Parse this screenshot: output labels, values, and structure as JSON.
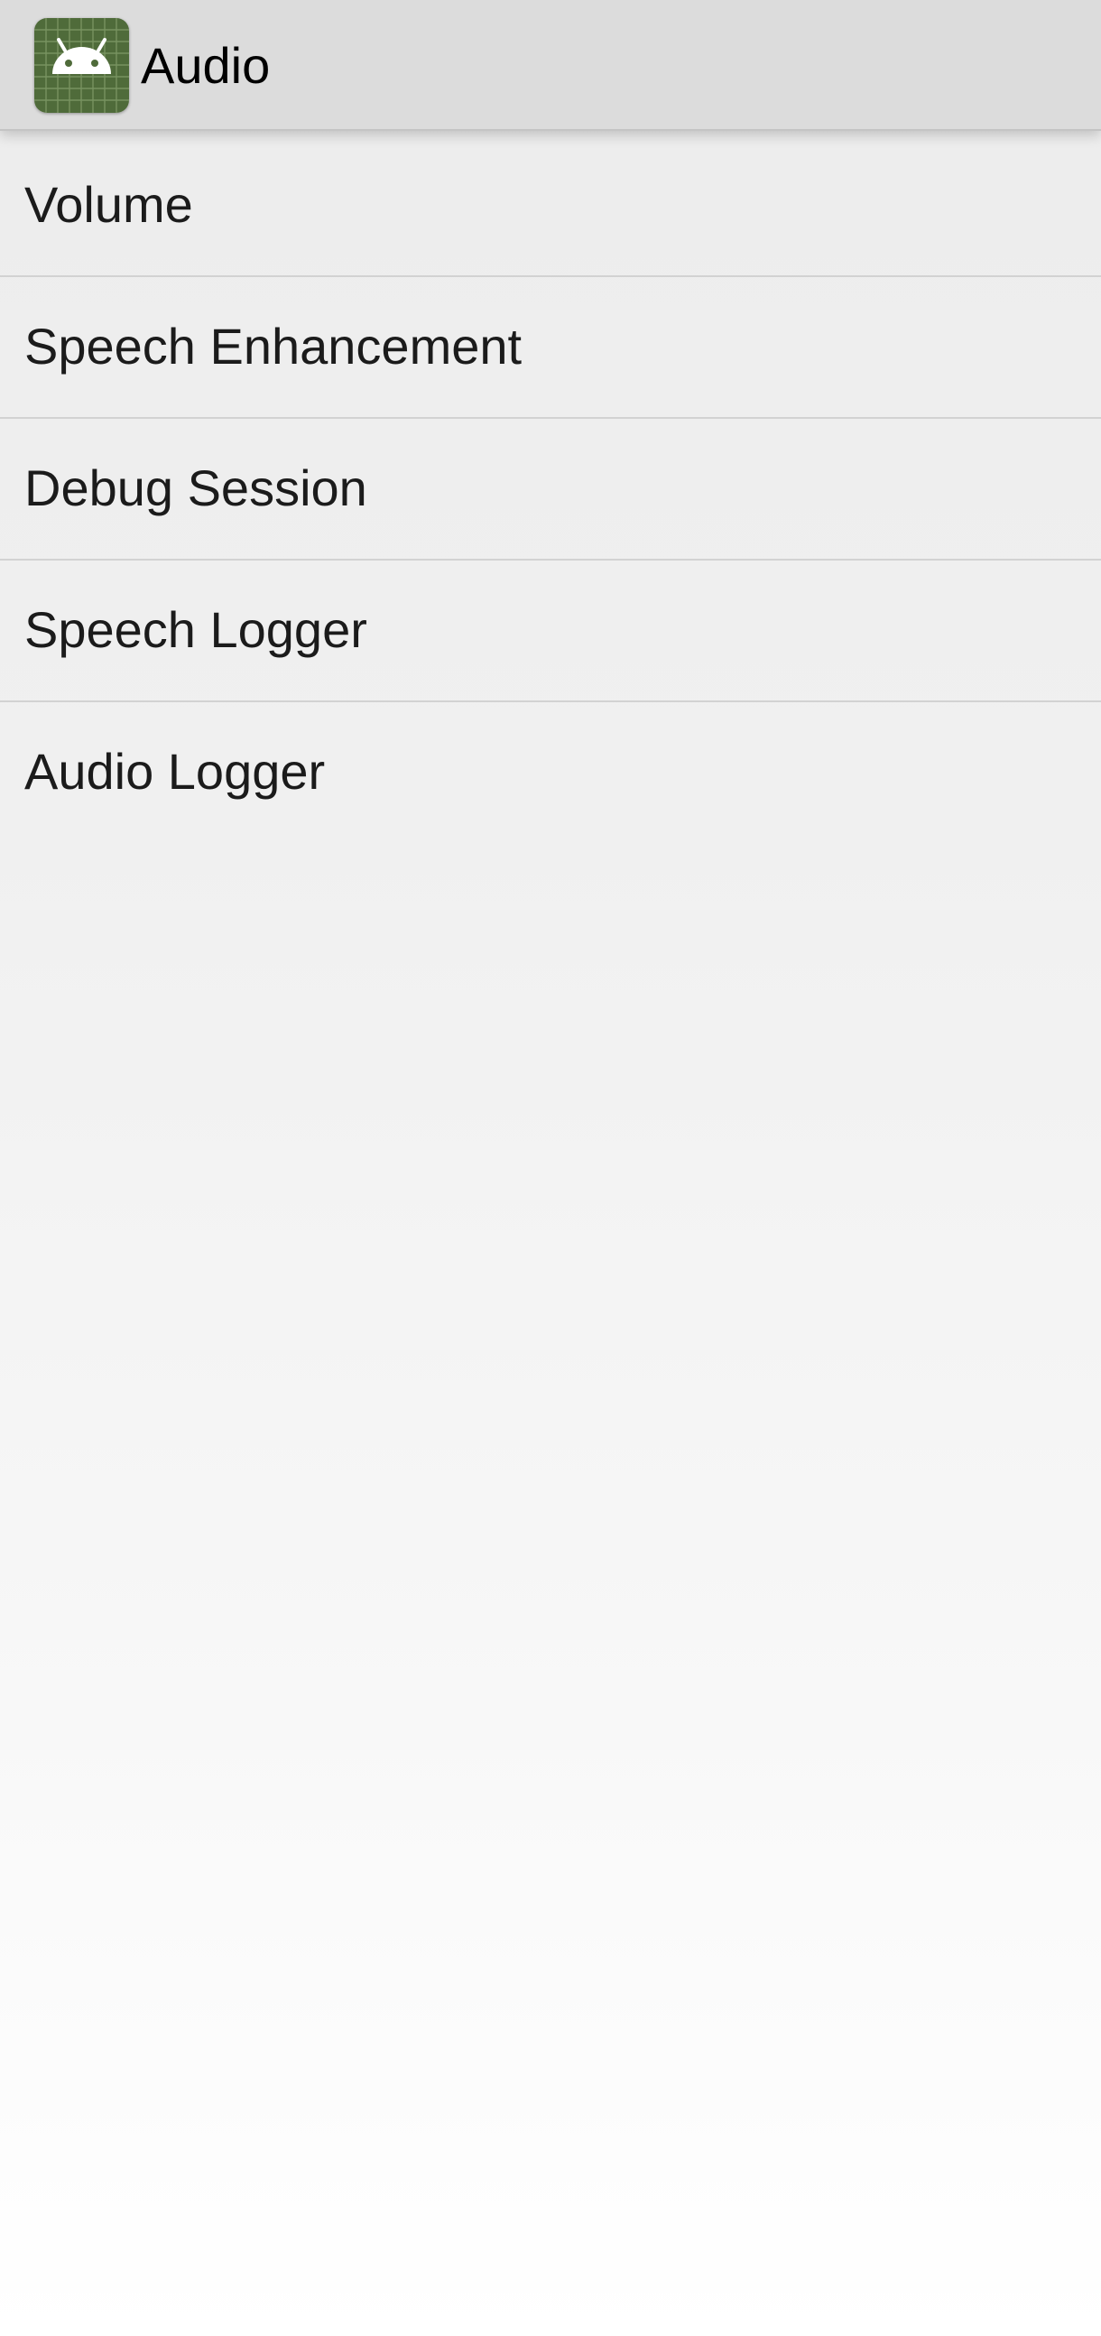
{
  "app_bar": {
    "title": "Audio",
    "icon": "android-robot-icon",
    "icon_bg_color": "#4f6b3a"
  },
  "menu": {
    "items": [
      {
        "label": "Volume"
      },
      {
        "label": "Speech Enhancement"
      },
      {
        "label": "Debug Session"
      },
      {
        "label": "Speech Logger"
      },
      {
        "label": "Audio Logger"
      }
    ]
  }
}
